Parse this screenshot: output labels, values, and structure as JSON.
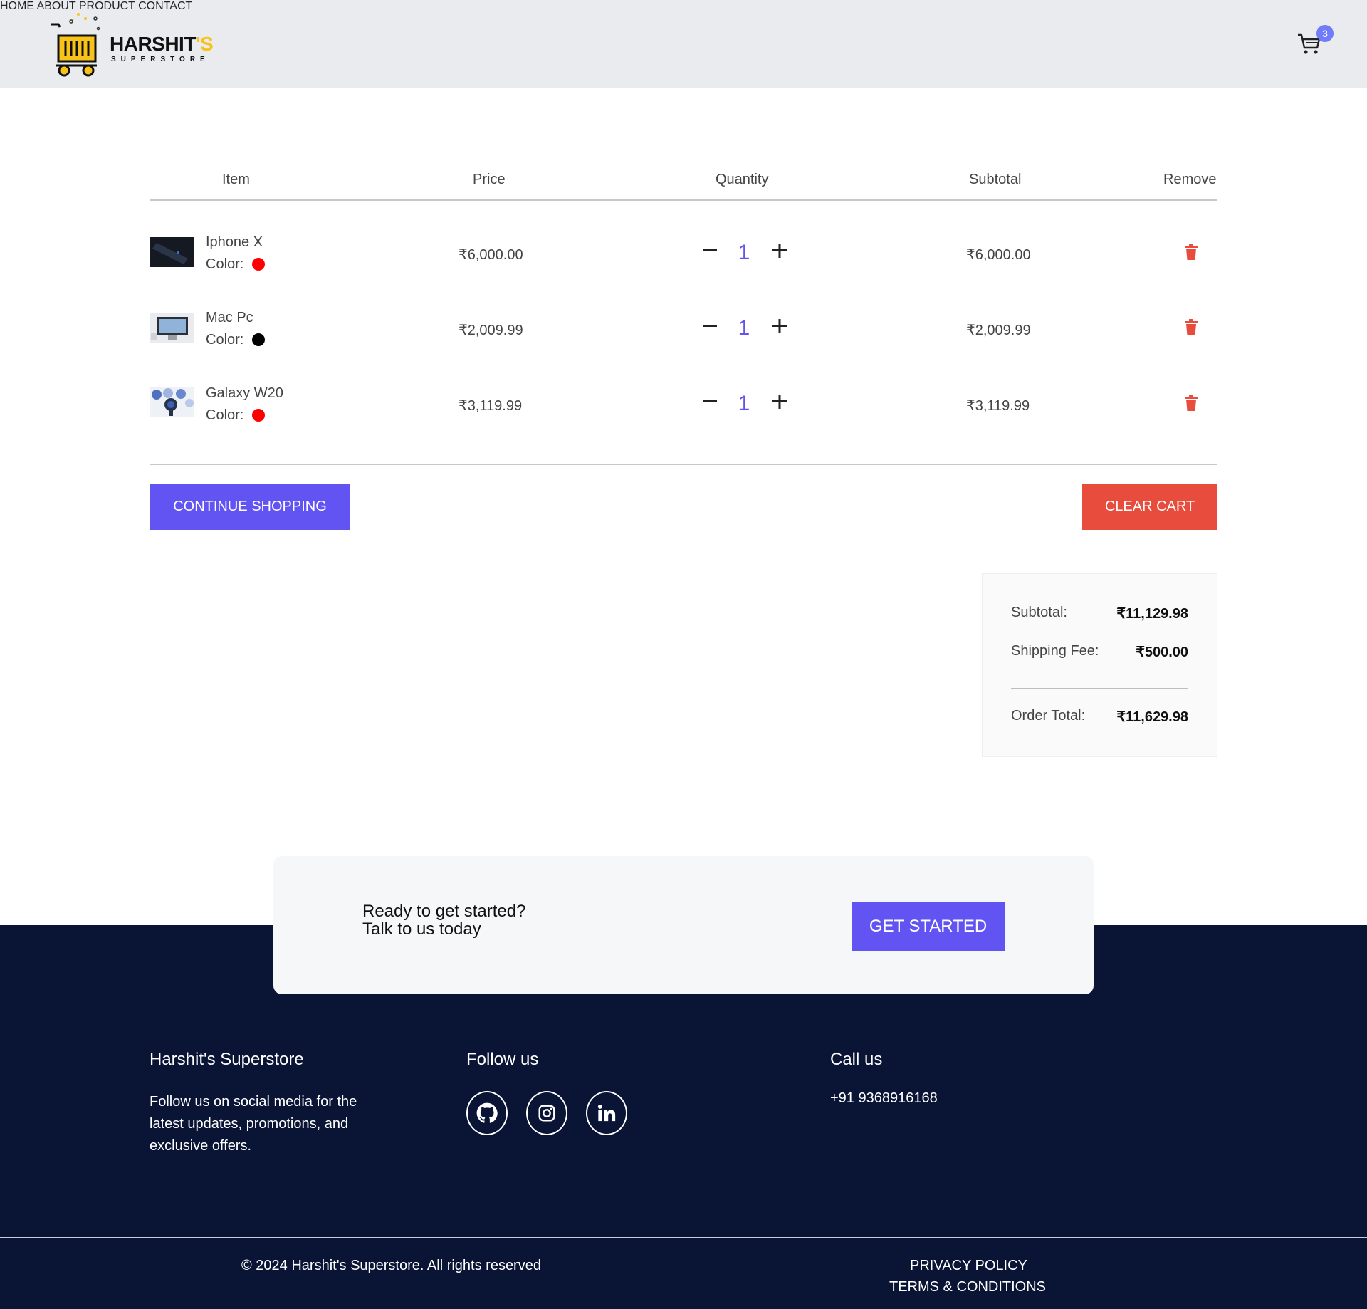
{
  "header": {
    "logo": {
      "name": "HARSHIT",
      "suffix": "'S",
      "tagline": "SUPERSTORE"
    },
    "nav": [
      "HOME",
      "ABOUT",
      "PRODUCT",
      "CONTACT"
    ],
    "cart_count": "3"
  },
  "cart": {
    "columns": [
      "Item",
      "Price",
      "Quantity",
      "Subtotal",
      "Remove"
    ],
    "color_label": "Color:",
    "items": [
      {
        "name": "Iphone X",
        "color": "#ff0000",
        "price": "₹6,000.00",
        "quantity": "1",
        "subtotal": "₹6,000.00"
      },
      {
        "name": "Mac Pc",
        "color": "#000000",
        "price": "₹2,009.99",
        "quantity": "1",
        "subtotal": "₹2,009.99"
      },
      {
        "name": "Galaxy W20",
        "color": "#ff0000",
        "price": "₹3,119.99",
        "quantity": "1",
        "subtotal": "₹3,119.99"
      }
    ],
    "continue_label": "CONTINUE SHOPPING",
    "clear_label": "CLEAR CART"
  },
  "summary": {
    "subtotal_label": "Subtotal:",
    "subtotal_value": "₹11,129.98",
    "shipping_label": "Shipping Fee:",
    "shipping_value": "₹500.00",
    "total_label": "Order Total:",
    "total_value": "₹11,629.98"
  },
  "cta": {
    "line1": "Ready to get started?",
    "line2": "Talk to us today",
    "button": "GET STARTED"
  },
  "footer": {
    "brand_title": "Harshit's Superstore",
    "brand_text": "Follow us on social media for the latest updates, promotions, and exclusive offers.",
    "follow_title": "Follow us",
    "social": [
      "github-icon",
      "instagram-icon",
      "linkedin-icon"
    ],
    "call_title": "Call us",
    "phone": "+91 9368916168",
    "copyright": "© 2024 Harshit's Superstore. All rights reserved",
    "links": [
      "PRIVACY POLICY",
      "TERMS & CONDITIONS"
    ]
  },
  "colors": {
    "primary": "#6254f3",
    "danger": "#e74c3c",
    "footer_bg": "#0a1435",
    "header_bg": "#eaebee"
  }
}
